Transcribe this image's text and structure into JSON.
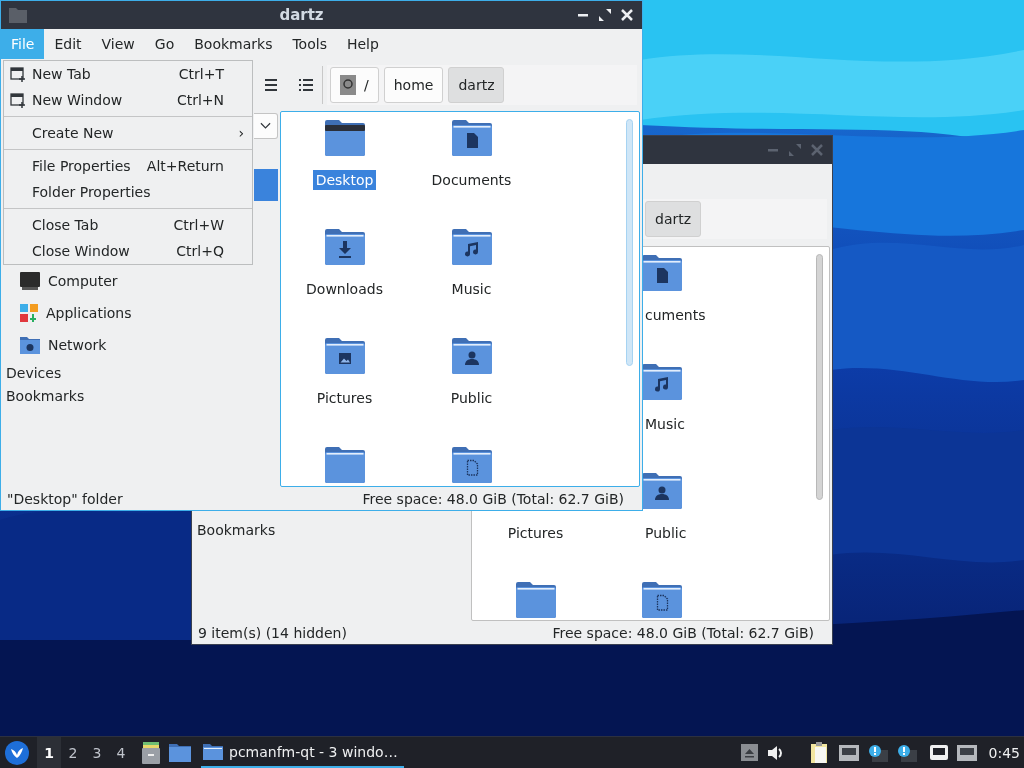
{
  "back_window": {
    "path": [
      {
        "label": "dartz",
        "selected": true
      }
    ],
    "sidebar_sections": [
      "Bookmarks"
    ],
    "rows": [
      {
        "right": {
          "kind": "documents",
          "label": "cuments"
        }
      },
      {
        "right": {
          "kind": "music",
          "label": "Music"
        }
      },
      {
        "left": {
          "label": "Pictures"
        },
        "right": {
          "kind": "public",
          "label": "Public"
        }
      },
      {
        "left": {
          "kind": "plain"
        },
        "right": {
          "kind": "template"
        }
      }
    ],
    "status": "9 item(s) (14 hidden)",
    "free_space": "Free space: 48.0 GiB (Total: 62.7 GiB)"
  },
  "front_window": {
    "title": "dartz",
    "menubar": [
      {
        "label": "File",
        "selected": true
      },
      {
        "label": "Edit",
        "selected": false
      },
      {
        "label": "View",
        "selected": false
      },
      {
        "label": "Go",
        "selected": false
      },
      {
        "label": "Bookmarks",
        "selected": false
      },
      {
        "label": "Tools",
        "selected": false
      },
      {
        "label": "Help",
        "selected": false
      }
    ],
    "path": [
      {
        "label": "/",
        "selected": false
      },
      {
        "label": "home",
        "selected": false
      },
      {
        "label": "dartz",
        "selected": true
      }
    ],
    "places": [
      {
        "selected": true
      },
      {
        "kind": "computer",
        "label": "Computer",
        "selected": false
      },
      {
        "kind": "applications",
        "label": "Applications",
        "selected": false
      },
      {
        "kind": "network",
        "label": "Network",
        "selected": false
      }
    ],
    "sidebar_sections": [
      "Devices",
      "Bookmarks"
    ],
    "items": [
      {
        "kind": "desktop",
        "label": "Desktop",
        "selected": true
      },
      {
        "kind": "documents",
        "label": "Documents",
        "selected": false
      },
      {
        "kind": "downloads",
        "label": "Downloads",
        "selected": false
      },
      {
        "kind": "music",
        "label": "Music",
        "selected": false
      },
      {
        "kind": "pictures",
        "label": "Pictures",
        "selected": false
      },
      {
        "kind": "public",
        "label": "Public",
        "selected": false
      },
      {
        "kind": "plain"
      },
      {
        "kind": "template"
      }
    ],
    "status": "\"Desktop\" folder",
    "free_space": "Free space: 48.0 GiB (Total: 62.7 GiB)"
  },
  "menu": {
    "items": [
      {
        "kind": "item",
        "has_icon": true,
        "label": "New Tab",
        "shortcut": "Ctrl+T"
      },
      {
        "kind": "item",
        "has_icon": true,
        "label": "New Window",
        "shortcut": "Ctrl+N"
      },
      {
        "kind": "separator"
      },
      {
        "kind": "submenu",
        "label": "Create New",
        "arrow": "›"
      },
      {
        "kind": "separator"
      },
      {
        "kind": "item",
        "has_icon": false,
        "label": "File Properties",
        "shortcut": "Alt+Return"
      },
      {
        "kind": "item",
        "has_icon": false,
        "label": "Folder Properties"
      },
      {
        "kind": "separator"
      },
      {
        "kind": "item",
        "has_icon": false,
        "label": "Close Tab",
        "shortcut": "Ctrl+W"
      },
      {
        "kind": "item",
        "has_icon": false,
        "label": "Close Window",
        "shortcut": "Ctrl+Q"
      }
    ]
  },
  "taskbar": {
    "workspaces": [
      {
        "label": "1",
        "selected": true
      },
      {
        "label": "2",
        "selected": false
      },
      {
        "label": "3",
        "selected": false
      },
      {
        "label": "4",
        "selected": false
      }
    ],
    "task": {
      "label": "pcmanfm-qt - 3 windo…",
      "selected": true
    },
    "clock": "0:45"
  }
}
